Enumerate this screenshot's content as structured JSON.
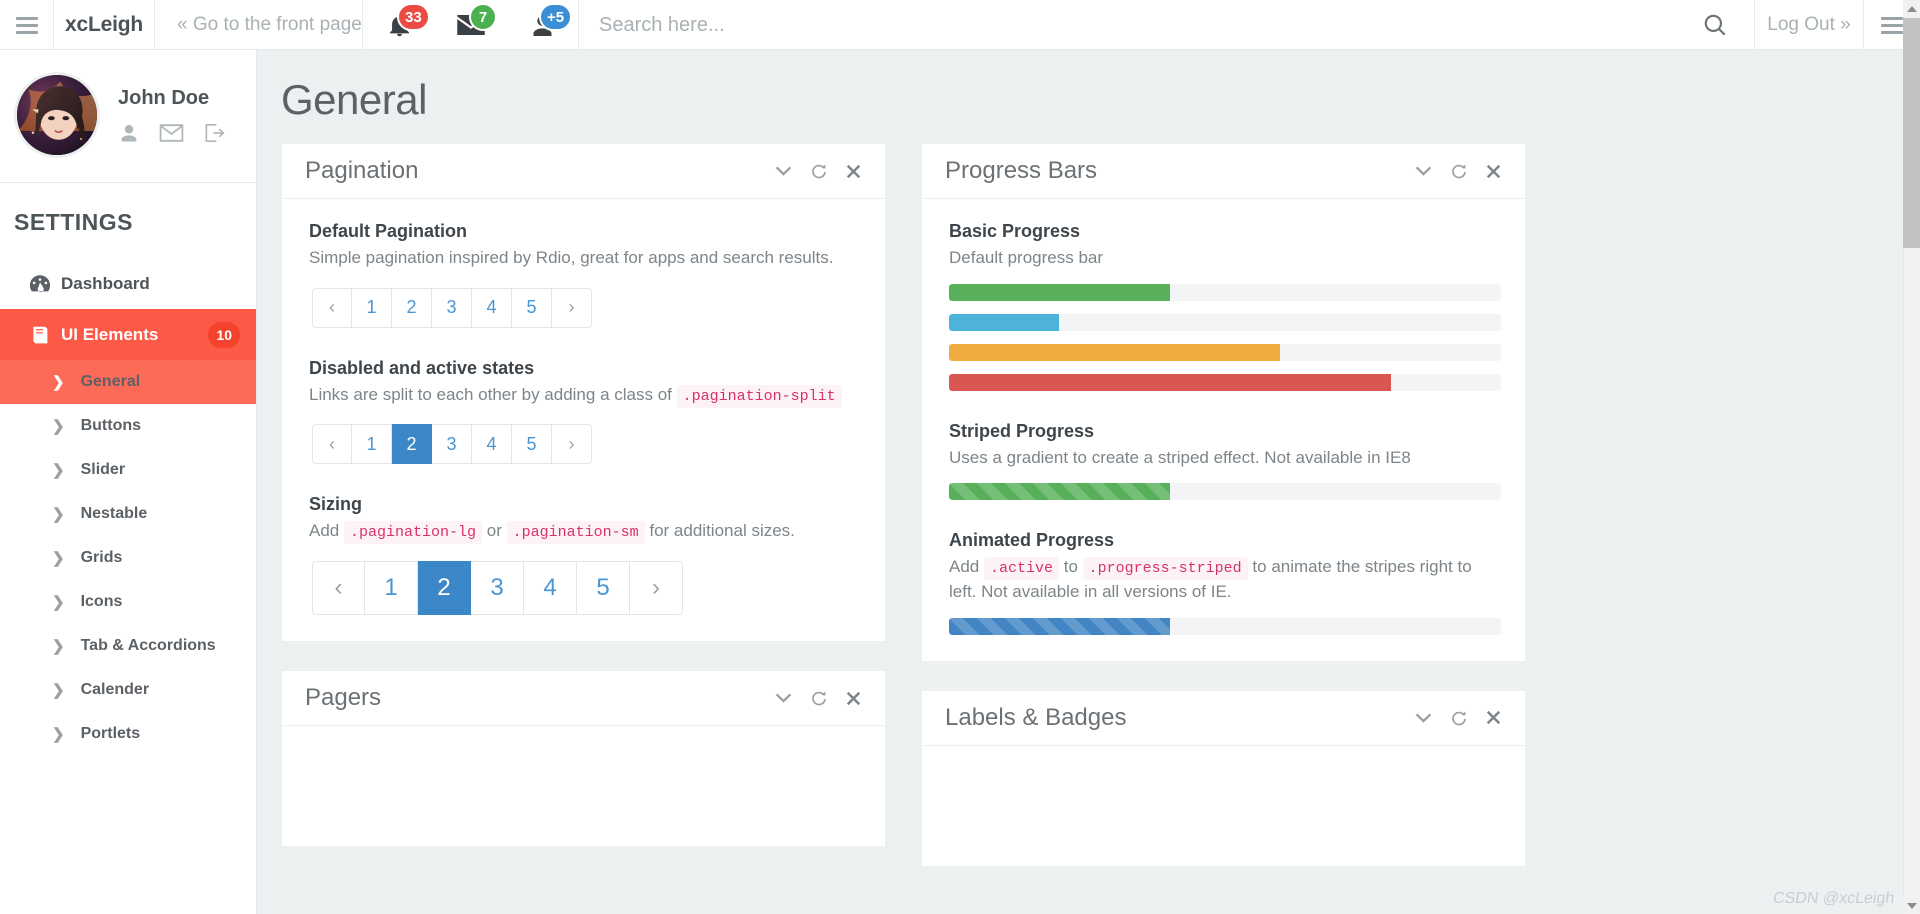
{
  "header": {
    "menu_icon": "hamburger-icon",
    "brand": "xcLeigh",
    "front_page_link": "« Go to the front page",
    "notifications": {
      "icon": "bell-icon",
      "count": "33",
      "color": "#ea4b42"
    },
    "messages": {
      "icon": "envelope-icon",
      "count": "7",
      "color": "#4caf50"
    },
    "users": {
      "icon": "user-icon",
      "count": "+5",
      "color": "#3a8fd4"
    },
    "search": {
      "placeholder": "Search here...",
      "value": "",
      "icon": "search-icon"
    },
    "logout": "Log Out »",
    "right_menu_icon": "hamburger-icon"
  },
  "sidebar": {
    "profile": {
      "name": "John Doe",
      "avatar": "avatar-image",
      "actions": [
        {
          "name": "profile-icon",
          "label": "Profile"
        },
        {
          "name": "inbox-icon",
          "label": "Inbox"
        },
        {
          "name": "logout-icon",
          "label": "Logout"
        }
      ]
    },
    "section_title": "SETTINGS",
    "items": [
      {
        "label": "Dashboard",
        "icon": "dashboard-icon",
        "active": false,
        "badge": ""
      },
      {
        "label": "UI Elements",
        "icon": "book-icon",
        "active": true,
        "badge": "10"
      }
    ],
    "subitems": [
      {
        "label": "General",
        "active": true
      },
      {
        "label": "Buttons",
        "active": false
      },
      {
        "label": "Slider",
        "active": false
      },
      {
        "label": "Nestable",
        "active": false
      },
      {
        "label": "Grids",
        "active": false
      },
      {
        "label": "Icons",
        "active": false
      },
      {
        "label": "Tab & Accordions",
        "active": false
      },
      {
        "label": "Calender",
        "active": false
      },
      {
        "label": "Portlets",
        "active": false
      }
    ]
  },
  "main": {
    "page_title": "General",
    "panel_tools": [
      "chevron-down-icon",
      "refresh-icon",
      "close-icon"
    ],
    "pagination_panel": {
      "title": "Pagination",
      "default": {
        "heading": "Default Pagination",
        "desc": "Simple pagination inspired by Rdio, great for apps and search results.",
        "prev": "‹",
        "next": "›",
        "pages": [
          "1",
          "2",
          "3",
          "4",
          "5"
        ],
        "active": ""
      },
      "states": {
        "heading": "Disabled and active states",
        "desc_before": "Links are split to each other by adding a class of",
        "code": ".pagination-split",
        "prev": "‹",
        "next": "›",
        "pages": [
          "1",
          "2",
          "3",
          "4",
          "5"
        ],
        "active": "2"
      },
      "sizing": {
        "heading": "Sizing",
        "desc_a": "Add",
        "code1": ".pagination-lg",
        "desc_b": "or",
        "code2": ".pagination-sm",
        "desc_c": "for additional sizes.",
        "prev": "‹",
        "next": "›",
        "pages": [
          "1",
          "2",
          "3",
          "4",
          "5"
        ],
        "active": "2"
      }
    },
    "progress_panel": {
      "title": "Progress Bars",
      "basic": {
        "heading": "Basic Progress",
        "desc": "Default progress bar",
        "bars": [
          {
            "color": "#58b15a",
            "pct": 40
          },
          {
            "color": "#4db3d9",
            "pct": 20
          },
          {
            "color": "#efab3f",
            "pct": 60
          },
          {
            "color": "#da5650",
            "pct": 80
          }
        ]
      },
      "striped": {
        "heading": "Striped Progress",
        "desc": "Uses a gradient to create a striped effect. Not available in IE8",
        "bars": [
          {
            "color": "#58b15a",
            "pct": 40
          }
        ]
      },
      "animated": {
        "heading": "Animated Progress",
        "desc_a": "Add",
        "code1": ".active",
        "desc_b": "to",
        "code2": ".progress-striped",
        "desc_c": "to animate the stripes right to left. Not available in all versions of IE.",
        "bars": [
          {
            "color": "#4285c4",
            "pct": 40
          }
        ]
      }
    },
    "pagers_panel": {
      "title": "Pagers"
    },
    "labels_panel": {
      "title": "Labels & Badges"
    }
  },
  "watermark": "CSDN @xcLeigh"
}
